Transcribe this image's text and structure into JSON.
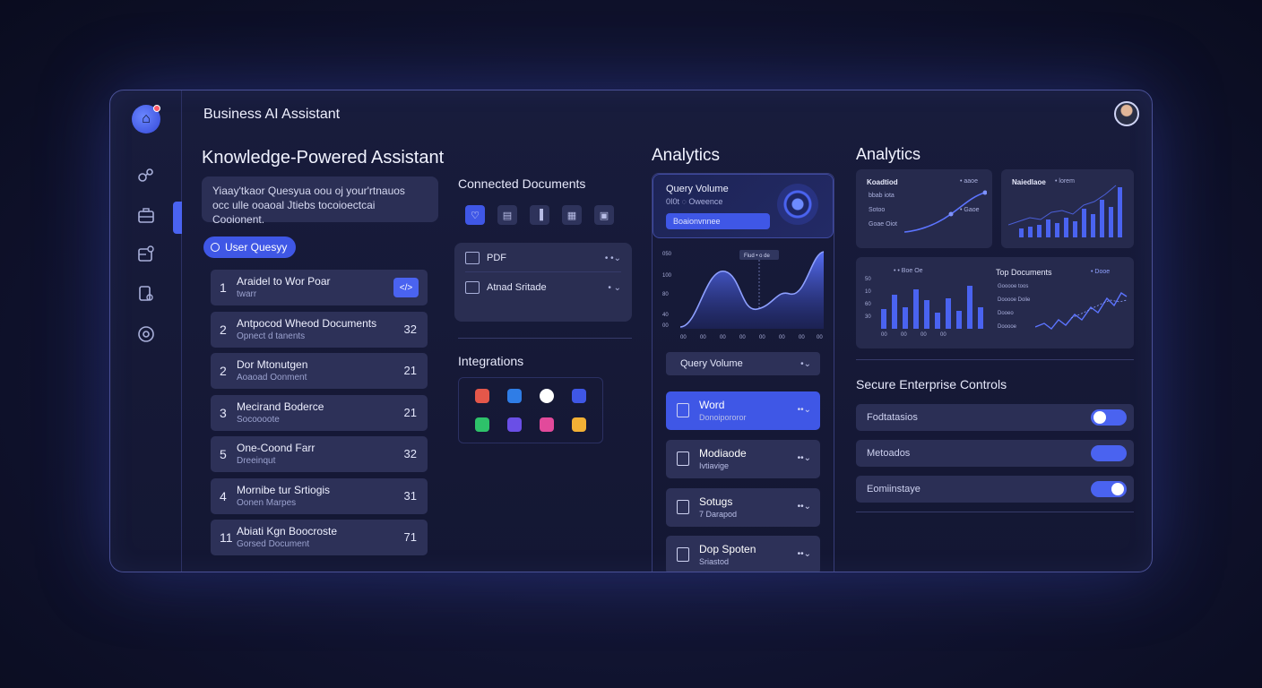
{
  "app": {
    "title": "Business AI Assistant"
  },
  "colors": {
    "accent": "#3f57e6",
    "panel": "#2d3158",
    "background": "#141733"
  },
  "sidebar": {
    "icons": [
      "network-icon",
      "briefcase-icon",
      "chart-icon",
      "document-search-icon",
      "at-icon"
    ]
  },
  "assistant": {
    "heading": "Knowledge-Powered Assistant",
    "prompt_line1": "Yiaay'tkaor Quesyua oou oj your'rtnauos",
    "prompt_line2": "occ ulle ooaoal Jtiebs tocoioectcai Cooionent.",
    "user_query_label": "User Quesyy",
    "queries": [
      {
        "num": "1",
        "title": "Araidel to Wor Poar",
        "sub": "twarr",
        "action": "</>"
      },
      {
        "num": "2",
        "title": "Antpocod Wheod Documents",
        "sub": "Opnect d tanents",
        "count": "32"
      },
      {
        "num": "2",
        "title": "Dor Mtonutgen",
        "sub": "Aoaoad Oonment",
        "count": "21"
      },
      {
        "num": "3",
        "title": "Mecirand Boderce",
        "sub": "Socoooote",
        "count": "21"
      },
      {
        "num": "5",
        "title": "One-Coond Farr",
        "sub": "Dreeinqut",
        "count": "32"
      },
      {
        "num": "4",
        "title": "Mornibe tur Srtiogis",
        "sub": "Oonen Marpes",
        "count": "31"
      },
      {
        "num": "11",
        "title": "Abiati Kgn Boocroste",
        "sub": "Gorsed Document",
        "count": "71"
      }
    ]
  },
  "connected": {
    "heading": "Connected Documents",
    "docs": [
      {
        "name": "PDF",
        "tail": "• •⌄"
      },
      {
        "name": "Atnad Sritade",
        "tail": "• ⌄"
      }
    ]
  },
  "integrations": {
    "heading": "Integrations"
  },
  "analytics_mid": {
    "heading": "Analytics",
    "card_title": "Query Volume",
    "card_sub": "0I0t ◌ Oweence",
    "card_button": "Boaionvnnee",
    "tooltip": "Fiud • o de",
    "y_ticks": [
      "050",
      "100",
      "80",
      "40",
      "00"
    ],
    "x_ticks": [
      "00",
      "00",
      "00",
      "00",
      "00",
      "00",
      "00",
      "00"
    ],
    "select_label": "Query Volume",
    "select_tail": "•⌄",
    "files": [
      {
        "name": "Word",
        "sub": "Donoipororor",
        "tail": "••⌄"
      },
      {
        "name": "Modiaode",
        "sub": "Ivtiavige",
        "tail": "••⌄"
      },
      {
        "name": "Sotugs",
        "sub": "7 Darapod",
        "tail": "••⌄"
      },
      {
        "name": "Dop Spoten",
        "sub": "Sriastod",
        "tail": "••⌄"
      }
    ]
  },
  "analytics_right": {
    "heading": "Analytics",
    "card1_title": "Koadtiod",
    "card1_tag": "• aaoe",
    "card1_lines": [
      "bbab iota",
      "Sotoo",
      "Goae Oiot"
    ],
    "card1_tail": "• Gaoe",
    "card2_title": "Naiedlaoe",
    "card2_tag": "• lorem",
    "card3_legend": "• • Boe Oe",
    "card3_y": [
      "50",
      "10",
      "60",
      "30"
    ],
    "card3_x": [
      "00",
      "00",
      "00",
      "00"
    ],
    "top_docs_title": "Top Documents",
    "top_docs_tag": "• Dooe",
    "top_docs_lines": [
      "Gooooe toos",
      "Dooooe Dolie",
      "Dooeo",
      "Dooooe"
    ]
  },
  "controls": {
    "heading": "Secure Enterprise Controls",
    "rows": [
      {
        "label": "Fodtatasios",
        "state": "on"
      },
      {
        "label": "Metoados",
        "state": "on"
      },
      {
        "label": "Eomiinstaye",
        "state": "on"
      }
    ]
  }
}
